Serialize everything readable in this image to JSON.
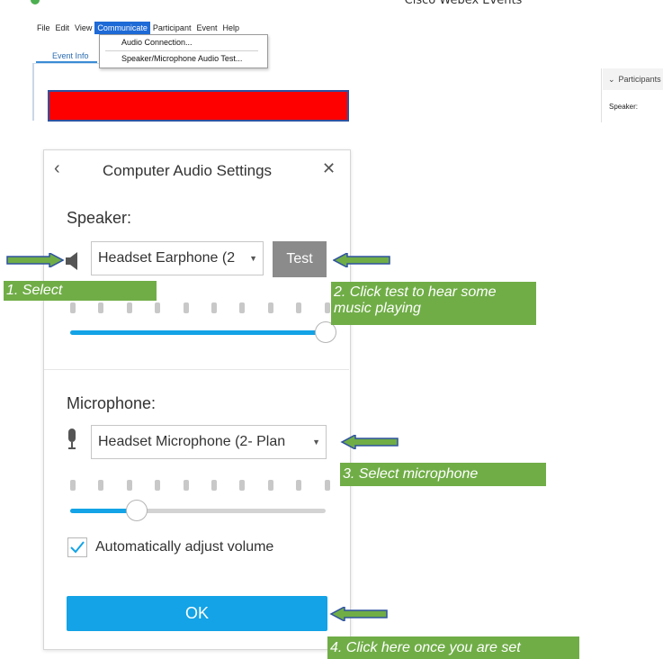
{
  "app": {
    "title": "Cisco Webex Events"
  },
  "menubar": {
    "items": [
      "File",
      "Edit",
      "View",
      "Communicate",
      "Participant",
      "Event",
      "Help"
    ],
    "active": "Communicate"
  },
  "communicate_menu": {
    "items": [
      "Audio Connection...",
      "Speaker/Microphone Audio Test..."
    ]
  },
  "tabs": {
    "event_info": "Event Info"
  },
  "right_panel": {
    "header": "Participants",
    "speaker_label": "Speaker:"
  },
  "dialog": {
    "title": "Computer Audio Settings",
    "speaker": {
      "label": "Speaker:",
      "device": "Headset Earphone (2",
      "test_label": "Test",
      "volume": 1.0
    },
    "microphone": {
      "label": "Microphone:",
      "device": "Headset Microphone (2- Plan",
      "volume": 0.26
    },
    "auto_adjust": {
      "label": "Automatically adjust volume",
      "checked": true
    },
    "ok_label": "OK"
  },
  "annotations": {
    "step1": "1. Select",
    "step2": "2. Click test to hear some music playing",
    "step3": "3. Select microphone",
    "step4": "4. Click here once you are set"
  },
  "colors": {
    "accent": "#13a3e6",
    "annotation": "#70ad47",
    "arrow_outline": "#2f52a0",
    "highlight_bar": "#ff0000"
  }
}
